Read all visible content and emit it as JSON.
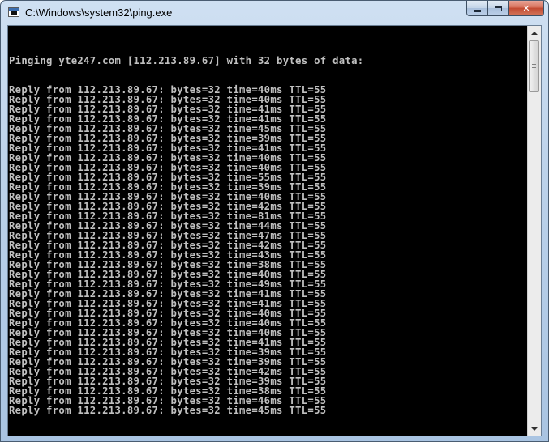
{
  "window": {
    "title": "C:\\Windows\\system32\\ping.exe",
    "icon": "console-app-icon"
  },
  "caption_buttons": {
    "minimize_icon": "minimize-icon",
    "maximize_icon": "maximize-icon",
    "close_label": "✕"
  },
  "console": {
    "header": "Pinging yte247.com [112.213.89.67] with 32 bytes of data:",
    "lines": [
      "Reply from 112.213.89.67: bytes=32 time=40ms TTL=55",
      "Reply from 112.213.89.67: bytes=32 time=40ms TTL=55",
      "Reply from 112.213.89.67: bytes=32 time=41ms TTL=55",
      "Reply from 112.213.89.67: bytes=32 time=41ms TTL=55",
      "Reply from 112.213.89.67: bytes=32 time=45ms TTL=55",
      "Reply from 112.213.89.67: bytes=32 time=39ms TTL=55",
      "Reply from 112.213.89.67: bytes=32 time=41ms TTL=55",
      "Reply from 112.213.89.67: bytes=32 time=40ms TTL=55",
      "Reply from 112.213.89.67: bytes=32 time=40ms TTL=55",
      "Reply from 112.213.89.67: bytes=32 time=55ms TTL=55",
      "Reply from 112.213.89.67: bytes=32 time=39ms TTL=55",
      "Reply from 112.213.89.67: bytes=32 time=40ms TTL=55",
      "Reply from 112.213.89.67: bytes=32 time=42ms TTL=55",
      "Reply from 112.213.89.67: bytes=32 time=81ms TTL=55",
      "Reply from 112.213.89.67: bytes=32 time=44ms TTL=55",
      "Reply from 112.213.89.67: bytes=32 time=47ms TTL=55",
      "Reply from 112.213.89.67: bytes=32 time=42ms TTL=55",
      "Reply from 112.213.89.67: bytes=32 time=43ms TTL=55",
      "Reply from 112.213.89.67: bytes=32 time=38ms TTL=55",
      "Reply from 112.213.89.67: bytes=32 time=40ms TTL=55",
      "Reply from 112.213.89.67: bytes=32 time=49ms TTL=55",
      "Reply from 112.213.89.67: bytes=32 time=41ms TTL=55",
      "Reply from 112.213.89.67: bytes=32 time=41ms TTL=55",
      "Reply from 112.213.89.67: bytes=32 time=40ms TTL=55",
      "Reply from 112.213.89.67: bytes=32 time=40ms TTL=55",
      "Reply from 112.213.89.67: bytes=32 time=40ms TTL=55",
      "Reply from 112.213.89.67: bytes=32 time=41ms TTL=55",
      "Reply from 112.213.89.67: bytes=32 time=39ms TTL=55",
      "Reply from 112.213.89.67: bytes=32 time=39ms TTL=55",
      "Reply from 112.213.89.67: bytes=32 time=42ms TTL=55",
      "Reply from 112.213.89.67: bytes=32 time=39ms TTL=55",
      "Reply from 112.213.89.67: bytes=32 time=38ms TTL=55",
      "Reply from 112.213.89.67: bytes=32 time=46ms TTL=55",
      "Reply from 112.213.89.67: bytes=32 time=45ms TTL=55"
    ]
  },
  "scrollbar": {
    "up_icon": "scroll-up-arrow-icon",
    "down_icon": "scroll-down-arrow-icon",
    "position": 0.0
  },
  "colors": {
    "console_bg": "#000000",
    "console_text": "#c0c0c0"
  }
}
